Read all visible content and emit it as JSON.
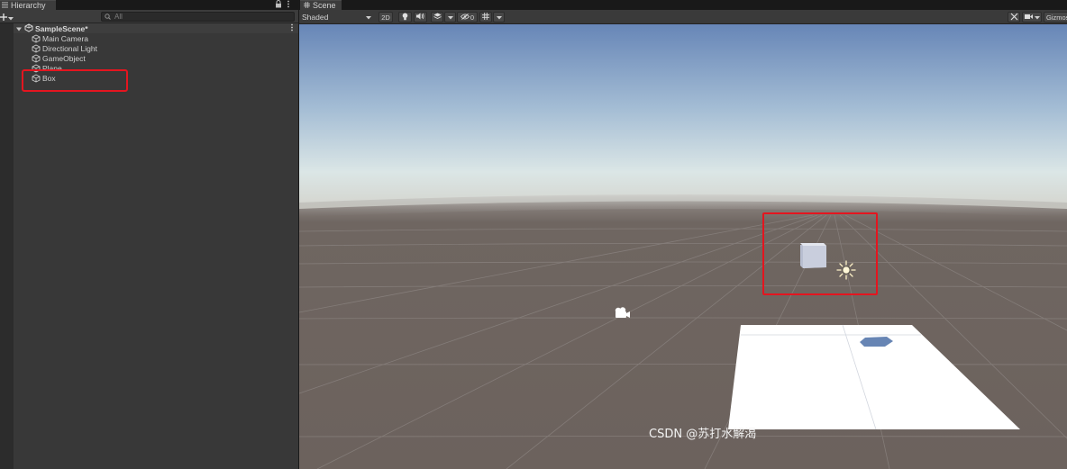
{
  "hierarchy": {
    "tab_label": "Hierarchy",
    "lock_icon": "lock-icon",
    "menu_icon": "kebab-menu-icon",
    "search": {
      "placeholder": "All"
    },
    "scene": {
      "name": "SampleScene*"
    },
    "items": [
      {
        "label": "Main Camera"
      },
      {
        "label": "Directional Light"
      },
      {
        "label": "GameObject"
      },
      {
        "label": "Plane"
      },
      {
        "label": "Box"
      }
    ]
  },
  "scene_view": {
    "tab_label": "Scene",
    "shading_mode": "Shaded",
    "toggle_2d": "2D",
    "hidden_count": "0",
    "gizmos_label": "Gizmos"
  },
  "watermark": "CSDN @苏打水解渴",
  "colors": {
    "highlight": "#e4151f",
    "sky_top": "#6e8cbc",
    "horizon": "#dfe8e8",
    "ground": "#6e6460",
    "plane": "#ffffff",
    "cube": "#cdd2de"
  }
}
